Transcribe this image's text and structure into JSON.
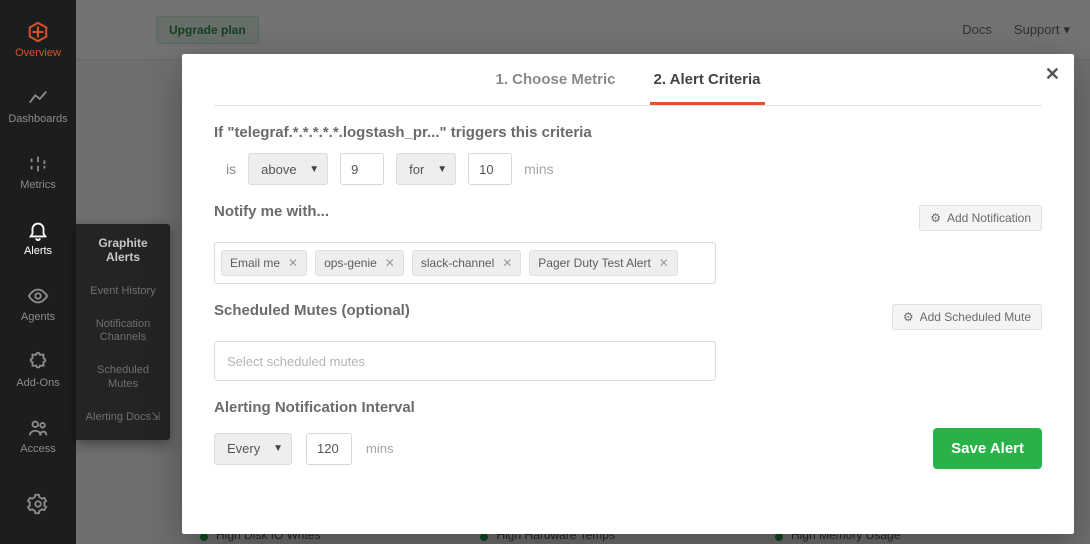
{
  "sidebar": {
    "items": [
      {
        "label": "Overview"
      },
      {
        "label": "Dashboards"
      },
      {
        "label": "Metrics"
      },
      {
        "label": "Alerts"
      },
      {
        "label": "Agents"
      },
      {
        "label": "Add-Ons"
      },
      {
        "label": "Access"
      }
    ]
  },
  "submenu": {
    "title": "Graphite Alerts",
    "items": [
      {
        "label": "Event History"
      },
      {
        "label": "Notification Channels"
      },
      {
        "label": "Scheduled Mutes"
      },
      {
        "label": "Alerting Docs⇲"
      }
    ]
  },
  "topbar": {
    "upgrade": "Upgrade plan",
    "docs": "Docs",
    "support": "Support"
  },
  "modal": {
    "tabs": [
      {
        "label": "1. Choose Metric"
      },
      {
        "label": "2. Alert Criteria"
      }
    ],
    "trigger_line": "If \"telegraf.*.*.*.*.*.logstash_pr...\" triggers this criteria",
    "criteria": {
      "is_label": "is",
      "comparator": "above",
      "value": "9",
      "for_label": "for",
      "duration": "10",
      "duration_unit": "mins"
    },
    "notify": {
      "title": "Notify me with...",
      "add_btn": "Add Notification",
      "chips": [
        {
          "label": "Email me"
        },
        {
          "label": "ops-genie"
        },
        {
          "label": "slack-channel"
        },
        {
          "label": "Pager Duty Test Alert"
        }
      ]
    },
    "mutes": {
      "title": "Scheduled Mutes (optional)",
      "add_btn": "Add Scheduled Mute",
      "placeholder": "Select scheduled mutes"
    },
    "interval": {
      "title": "Alerting Notification Interval",
      "mode": "Every",
      "value": "120",
      "unit": "mins"
    },
    "save": "Save Alert"
  },
  "bgcards": [
    {
      "label": "High Disk IO Writes"
    },
    {
      "label": "High Hardware Temps"
    },
    {
      "label": "High Memory Usage"
    }
  ]
}
